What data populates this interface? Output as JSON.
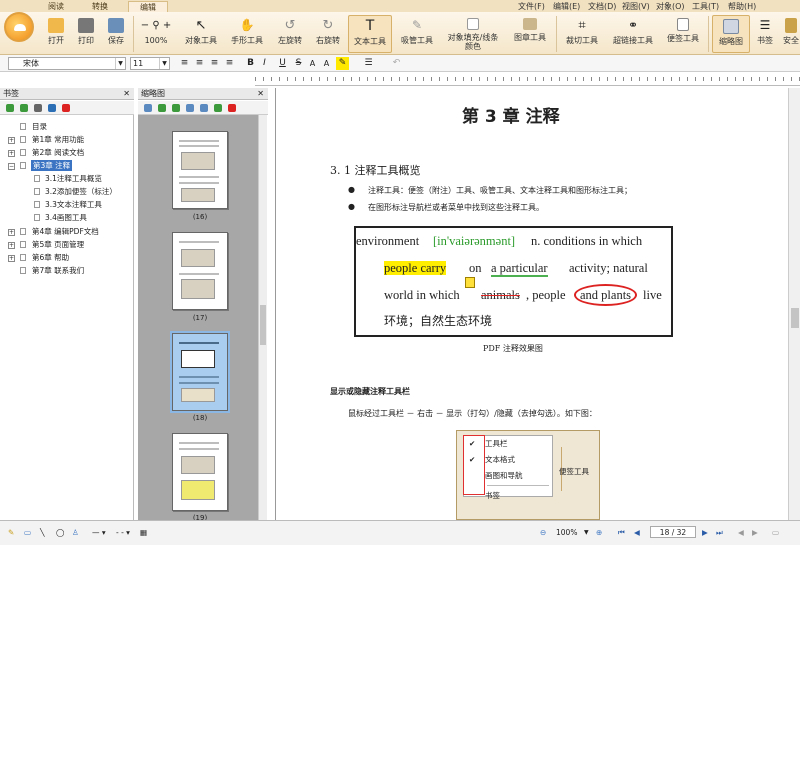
{
  "tabs": [
    "阅读",
    "转换",
    "编辑"
  ],
  "menus": [
    "文件(F)",
    "编辑(E)",
    "文档(D)",
    "视图(V)",
    "对象(O)",
    "工具(T)",
    "帮助(H)"
  ],
  "ribbon": {
    "open": "打开",
    "print": "打印",
    "save": "保存",
    "zoom": "100%",
    "object_tool": "对象工具",
    "hand_tool": "手形工具",
    "rotate_left": "左旋转",
    "rotate_right": "右旋转",
    "text_tool": "文本工具",
    "eyedropper_tool": "吸管工具",
    "fill_stroke_1": "对象填充/线条",
    "fill_stroke_2": "颜色",
    "image_tool": "图章工具",
    "crop_tool": "裁切工具",
    "link_tool": "超链接工具",
    "note_tool": "便签工具",
    "thumbnail": "缩略图",
    "bookmark": "书签",
    "security": "安全"
  },
  "format": {
    "font": "宋体",
    "size": "11",
    "bold": "B",
    "italic": "I",
    "underline": "U",
    "strike": "S",
    "superscript": "A",
    "subscript": "A"
  },
  "bookmark_panel": {
    "title": "书签",
    "items": [
      "目录",
      "第1章 常用功能",
      "第2章 阅读文档",
      "第3章 注释",
      "3.1注释工具概览",
      "3.2添加便签（标注）",
      "3.3文本注释工具",
      "3.4画图工具",
      "第4章 编辑PDF文档",
      "第5章 页面管理",
      "第6章 帮助",
      "第7章 联系我们"
    ]
  },
  "thumb_panel": {
    "title": "缩略图",
    "labels": [
      "(16)",
      "(17)",
      "(18)",
      "(19)"
    ]
  },
  "document": {
    "chapter_title": "第 3 章  注释",
    "section": "3. 1 注释工具概览",
    "bullet1": "注释工具：便签（附注）工具、吸管工具、文本注释工具和图形标注工具；",
    "bullet2": "在图形标注导航栏或者菜单中找到这些注释工具。",
    "figure": {
      "l1_a": "environment",
      "l1_phon": "[in'vaiərənmənt]",
      "l1_b": "n.  conditions  in  which",
      "l2_hl": "people  carry",
      "l2_on": "on",
      "l2_ul": "a  particular",
      "l2_b": "activity;  natural",
      "l3_a": "world  in  which",
      "l3_strike": "animals",
      "l3_b": ",  people",
      "l3_circ": "and  plants",
      "l3_c": "live",
      "l4": "环境；自然生态环境"
    },
    "figure_caption": "PDF 注释效果图",
    "subheading": "显示或隐藏注释工具栏",
    "instruction": "鼠标经过工具栏 － 右击 － 显示（打勾）/隐藏（去掉勾选）。如下图：",
    "context_menu": [
      "工具栏",
      "文本格式",
      "画图和导航",
      "书签"
    ],
    "context_side": "便签工具"
  },
  "status": {
    "zoom": "100%",
    "page": "18 / 32"
  }
}
